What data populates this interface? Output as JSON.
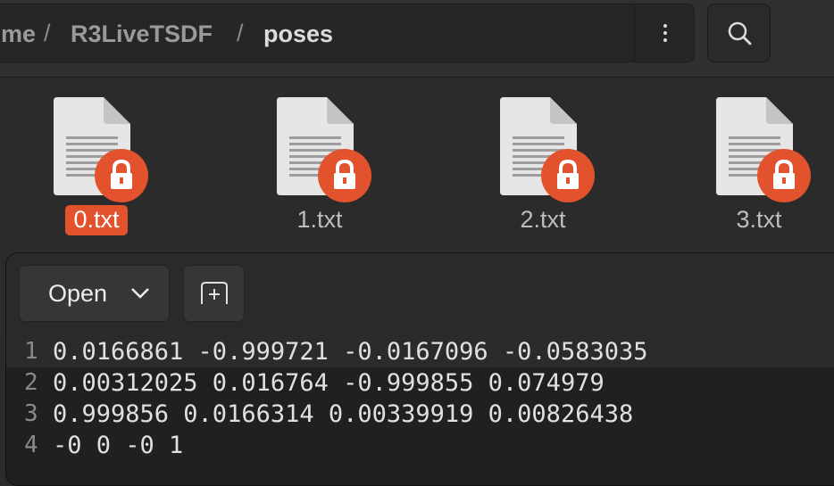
{
  "header": {
    "breadcrumbs": [
      "me",
      "R3LiveTSDF",
      "poses"
    ],
    "separator": "/",
    "menu_icon": "kebab-menu-icon",
    "search_icon": "search-icon"
  },
  "files": [
    {
      "name": "0.txt",
      "selected": true,
      "locked": true
    },
    {
      "name": "1.txt",
      "selected": false,
      "locked": true
    },
    {
      "name": "2.txt",
      "selected": false,
      "locked": true
    },
    {
      "name": "3.txt",
      "selected": false,
      "locked": true
    }
  ],
  "preview": {
    "open_label": "Open",
    "pin_icon": "pin-window-icon",
    "lines": [
      {
        "number": "1",
        "text": "0.0166861 -0.999721 -0.0167096 -0.0583035"
      },
      {
        "number": "2",
        "text": "0.00312025 0.016764 -0.999855 0.074979"
      },
      {
        "number": "3",
        "text": "0.999856 0.0166314 0.00339919 0.00826438"
      },
      {
        "number": "4",
        "text": "-0 0 -0 1"
      }
    ]
  },
  "colors": {
    "accent": "#e2532d",
    "background": "#2b2b2b",
    "text": "#e0e0e0"
  }
}
